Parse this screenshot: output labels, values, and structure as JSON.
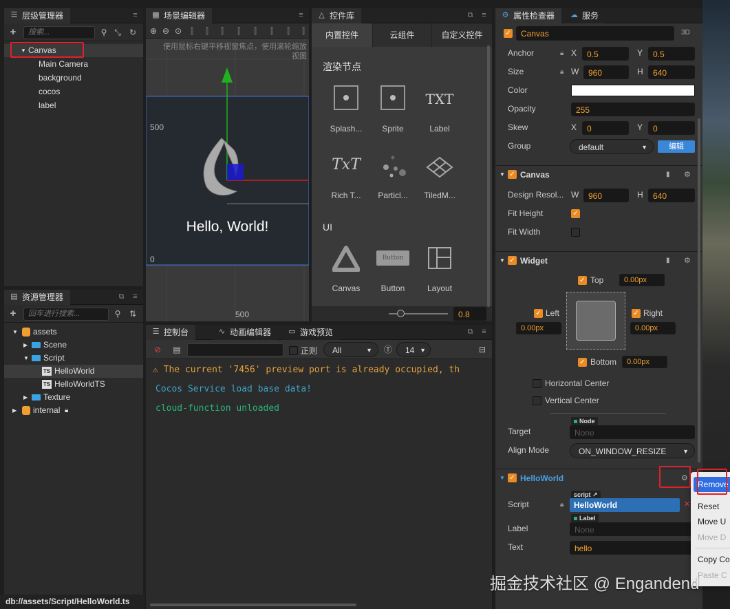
{
  "hierarchy": {
    "tab": "层级管理器",
    "search_placeholder": "搜索...",
    "nodes": [
      "Canvas",
      "Main Camera",
      "background",
      "cocos",
      "label"
    ]
  },
  "scene": {
    "tab": "场景编辑器",
    "hint_line1": "使用鼠标右键平移视窗焦点，使用滚轮缩放",
    "hint_line2": "视图",
    "axis_500": "500",
    "axis_0": "0",
    "axis_x500": "500",
    "canvas_text": "Hello, World!"
  },
  "widget_library": {
    "tab": "控件库",
    "tabs": [
      "内置控件",
      "云组件",
      "自定义控件"
    ],
    "section_render": "渲染节点",
    "section_ui": "UI",
    "render_items": [
      "Splash...",
      "Sprite",
      "Label",
      "Rich T...",
      "Particl...",
      "TiledM..."
    ],
    "ui_items": [
      "Canvas",
      "Button",
      "Layout"
    ],
    "txt_glyph": "TXT",
    "rich_glyph": "TxT",
    "button_glyph": "Button",
    "zoom_value": "0.8"
  },
  "assets": {
    "tab": "资源管理器",
    "search_placeholder": "回车进行搜索...",
    "items": [
      "assets",
      "Scene",
      "Script",
      "HelloWorld",
      "HelloWorldTS",
      "Texture",
      "internal"
    ],
    "status_path": "db://assets/Script/HelloWorld.ts"
  },
  "console": {
    "tabs": [
      "控制台",
      "动画编辑器",
      "游戏预览"
    ],
    "regex_label": "正则",
    "filter_value": "All",
    "font_size": "14",
    "lines": [
      {
        "text": "The current '7456' preview port is already occupied, th",
        "color": "#e6a23c"
      },
      {
        "text": "Cocos Service load base data!",
        "color": "#3ea1c7"
      },
      {
        "text": "cloud-function unloaded",
        "color": "#2ab47a"
      }
    ]
  },
  "inspector": {
    "tab": "属性检查器",
    "tab2": "服务",
    "node_name": "Canvas",
    "badge_3d": "3D",
    "anchor": {
      "label": "Anchor",
      "x": "0.5",
      "y": "0.5"
    },
    "size": {
      "label": "Size",
      "w": "960",
      "h": "640"
    },
    "color_label": "Color",
    "opacity": {
      "label": "Opacity",
      "value": "255"
    },
    "skew": {
      "label": "Skew",
      "x": "0",
      "y": "0"
    },
    "group": {
      "label": "Group",
      "value": "default",
      "edit": "编辑"
    },
    "axis_x": "X",
    "axis_y": "Y",
    "axis_w": "W",
    "axis_h": "H",
    "canvas_comp": {
      "title": "Canvas",
      "design_label": "Design Resol...",
      "w": "960",
      "h": "640",
      "fit_height": "Fit Height",
      "fit_width": "Fit Width"
    },
    "widget_comp": {
      "title": "Widget",
      "top": "Top",
      "top_val": "0.00px",
      "left": "Left",
      "left_val": "0.00px",
      "right": "Right",
      "right_val": "0.00px",
      "bottom": "Bottom",
      "bottom_val": "0.00px",
      "hcenter": "Horizontal Center",
      "vcenter": "Vertical Center",
      "target_label": "Target",
      "target_tag": "Node",
      "target_val": "None",
      "align_label": "Align Mode",
      "align_val": "ON_WINDOW_RESIZE"
    },
    "hello_comp": {
      "title": "HelloWorld",
      "script_label": "Script",
      "script_tag": "script",
      "script_val": "HelloWorld",
      "label_label": "Label",
      "label_tag": "Label",
      "label_val": "None",
      "text_label": "Text",
      "text_val": "hello"
    }
  },
  "context_menu": {
    "items": [
      "Remove",
      "Reset",
      "Move U",
      "Move D",
      "Copy Co",
      "Paste C"
    ]
  },
  "watermark": "掘金技术社区 @ Engandend"
}
